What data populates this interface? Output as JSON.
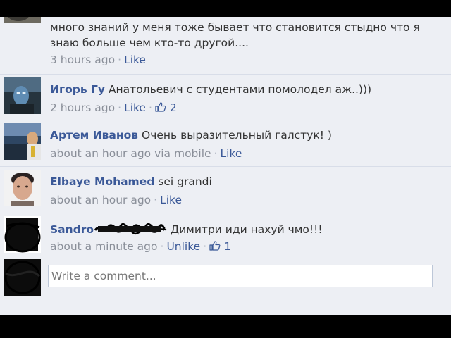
{
  "comments": [
    {
      "text_line1": "много знаний у меня тоже бывает что становится стыдно что я",
      "text_line2": "знаю больше чем кто-то другой....",
      "time": "3 hours ago",
      "like_label": "Like",
      "avatar_icon": "avatar-photo"
    },
    {
      "author": "Игорь Гу",
      "text": "Анатольевич с студентами помолодел аж..)))",
      "time": "2 hours ago",
      "like_label": "Like",
      "like_count": "2",
      "avatar_icon": "avatar-photo"
    },
    {
      "author": "Артем Иванов",
      "text": "Очень выразительный галстук! )",
      "time": "about an hour ago via mobile",
      "like_label": "Like",
      "avatar_icon": "avatar-photo"
    },
    {
      "author": "Elbaye Mohamed",
      "text": "sei grandi",
      "time": "about an hour ago",
      "like_label": "Like",
      "avatar_icon": "avatar-photo"
    },
    {
      "author": "Sandro",
      "text": "Димитри иди нахуй чмо!!!",
      "time": "about a minute ago",
      "like_label": "Unlike",
      "like_count": "1",
      "avatar_icon": "avatar-scribbled-out"
    }
  ],
  "composer": {
    "placeholder": "Write a comment...",
    "avatar_icon": "avatar-scribbled-out"
  },
  "colors": {
    "link": "#3b5998",
    "panel_bg": "#edeff4",
    "meta_text": "#8a8f99",
    "letterbox": "#000000"
  }
}
